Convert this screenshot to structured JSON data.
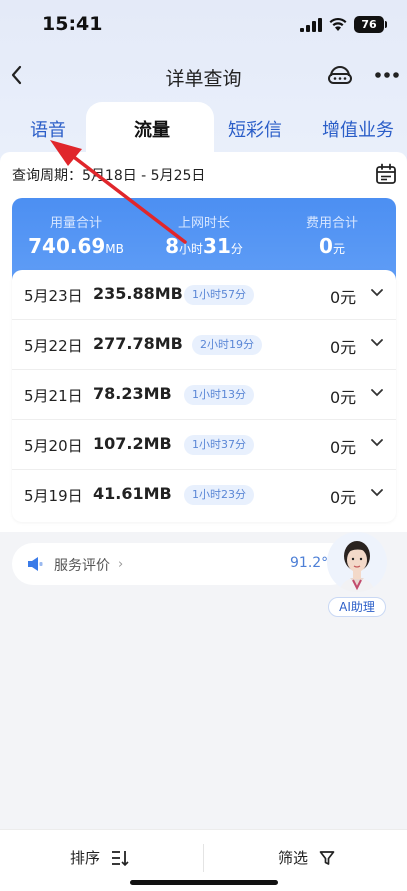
{
  "status_bar": {
    "time": "15:41",
    "battery": "76"
  },
  "nav": {
    "title": "详单查询",
    "back_icon": "chevron-left-icon",
    "service_icon": "customer-service-icon",
    "more_icon": "more-icon"
  },
  "tabs": [
    {
      "label": "语音",
      "active": false
    },
    {
      "label": "流量",
      "active": true
    },
    {
      "label": "短彩信",
      "active": false
    },
    {
      "label": "增值业务",
      "active": false
    }
  ],
  "period": {
    "label": "查询周期：5月18日 - 5月25日"
  },
  "summary": {
    "usage_label": "用量合计",
    "usage_value": "740.69",
    "usage_unit": "MB",
    "online_label": "上网时长",
    "online_hours": "8",
    "online_hours_unit": "小时",
    "online_minutes": "31",
    "online_minutes_unit": "分",
    "fee_label": "费用合计",
    "fee_value": "0",
    "fee_unit": "元"
  },
  "records": [
    {
      "date": "5月23日",
      "amount": "235.88MB",
      "duration": "1小时57分",
      "fee": "0元"
    },
    {
      "date": "5月22日",
      "amount": "277.78MB",
      "duration": "2小时19分",
      "fee": "0元"
    },
    {
      "date": "5月21日",
      "amount": "78.23MB",
      "duration": "1小时13分",
      "fee": "0元"
    },
    {
      "date": "5月20日",
      "amount": "107.2MB",
      "duration": "1小时37分",
      "fee": "0元"
    },
    {
      "date": "5月19日",
      "amount": "41.61MB",
      "duration": "1小时23分",
      "fee": "0元"
    }
  ],
  "rating": {
    "label": "服务评价",
    "chevron": "›",
    "score": "91.2°"
  },
  "assistant": {
    "label": "AI助理"
  },
  "bottom": {
    "sort_label": "排序",
    "filter_label": "筛选"
  },
  "colors": {
    "accent": "#2b5ec8",
    "summary_bg": "#4c8ff2",
    "annotation": "#e0262b"
  }
}
